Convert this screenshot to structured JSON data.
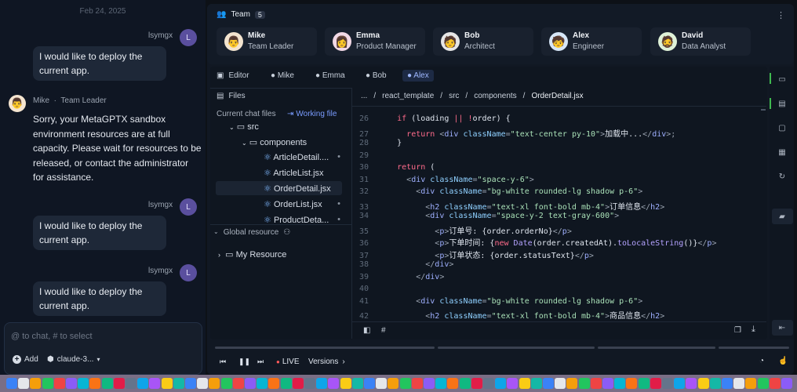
{
  "chat": {
    "date": "Feb 24, 2025",
    "user_name": "lsymgx",
    "user_initial": "L",
    "user_message": "I would like to deploy the current app.",
    "bot_name": "Mike",
    "bot_role": "Team Leader",
    "bot_message": "Sorry, your MetaGPTX sandbox environment resources are at full capacity. Please wait for resources to be released, or contact the administrator for assistance.",
    "input_placeholder": "@ to chat, # to select",
    "add_label": "Add",
    "model_label": "claude-3..."
  },
  "team": {
    "title": "Team",
    "count": "5",
    "members": [
      {
        "name": "Mike",
        "role": "Team Leader"
      },
      {
        "name": "Emma",
        "role": "Product Manager"
      },
      {
        "name": "Bob",
        "role": "Architect"
      },
      {
        "name": "Alex",
        "role": "Engineer"
      },
      {
        "name": "David",
        "role": "Data Analyst"
      }
    ]
  },
  "editor": {
    "title": "Editor",
    "tabs": [
      "Mike",
      "Emma",
      "Bob",
      "Alex"
    ],
    "active_tab": "Alex",
    "files_label": "Files",
    "current_chat_files": "Current chat files",
    "working_file": "Working file",
    "breadcrumb": [
      "...",
      "react_template",
      "src",
      "components",
      "OrderDetail.jsx"
    ],
    "tree": {
      "src": "src",
      "components": "components",
      "files": [
        "ArticleDetail....",
        "ArticleList.jsx",
        "OrderDetail.jsx",
        "OrderList.jsx",
        "ProductDeta..."
      ],
      "global_resource": "Global resource",
      "my_resource": "My Resource"
    },
    "code_lines": [
      {
        "n": "26",
        "html": "      <span class='kw'>if</span> <span class='pl'>(loading</span> <span class='kw'>||</span> <span class='kw'>!</span><span class='pl'>order) {</span>"
      },
      {
        "n": "27",
        "html": "        <span class='kw'>return</span> <span class='pu'>&lt;</span><span class='tg'>div</span> <span class='at'>className</span><span class='pu'>=</span><span class='st'>\"text-center py-10\"</span><span class='pu'>&gt;</span><span class='pl'>加载中...</span><span class='pu'>&lt;/</span><span class='tg'>div</span><span class='pu'>&gt;;</span>"
      },
      {
        "n": "28",
        "html": "      <span class='pl'>}</span>"
      },
      {
        "n": "29",
        "html": ""
      },
      {
        "n": "30",
        "html": "      <span class='kw'>return</span> <span class='pl'>(</span>"
      },
      {
        "n": "31",
        "html": "        <span class='pu'>&lt;</span><span class='tg'>div</span> <span class='at'>className</span><span class='pu'>=</span><span class='st'>\"space-y-6\"</span><span class='pu'>&gt;</span>"
      },
      {
        "n": "32",
        "html": "          <span class='pu'>&lt;</span><span class='tg'>div</span> <span class='at'>className</span><span class='pu'>=</span><span class='st'>\"bg-white rounded-lg shadow p-6\"</span><span class='pu'>&gt;</span>"
      },
      {
        "n": "33",
        "html": "            <span class='pu'>&lt;</span><span class='tg'>h2</span> <span class='at'>className</span><span class='pu'>=</span><span class='st'>\"text-xl font-bold mb-4\"</span><span class='pu'>&gt;</span><span class='pl'>订单信息</span><span class='pu'>&lt;/</span><span class='tg'>h2</span><span class='pu'>&gt;</span>"
      },
      {
        "n": "34",
        "html": "            <span class='pu'>&lt;</span><span class='tg'>div</span> <span class='at'>className</span><span class='pu'>=</span><span class='st'>\"space-y-2 text-gray-600\"</span><span class='pu'>&gt;</span>"
      },
      {
        "n": "35",
        "html": "              <span class='pu'>&lt;</span><span class='tg'>p</span><span class='pu'>&gt;</span><span class='pl'>订单号: {order.orderNo}</span><span class='pu'>&lt;/</span><span class='tg'>p</span><span class='pu'>&gt;</span>"
      },
      {
        "n": "36",
        "html": "              <span class='pu'>&lt;</span><span class='tg'>p</span><span class='pu'>&gt;</span><span class='pl'>下单时间: {</span><span class='kw'>new</span> <span class='fn'>Date</span><span class='pl'>(order.createdAt).</span><span class='fn'>toLocaleString</span><span class='pl'>()}</span><span class='pu'>&lt;/</span><span class='tg'>p</span><span class='pu'>&gt;</span>"
      },
      {
        "n": "37",
        "html": "              <span class='pu'>&lt;</span><span class='tg'>p</span><span class='pu'>&gt;</span><span class='pl'>订单状态: {order.statusText}</span><span class='pu'>&lt;/</span><span class='tg'>p</span><span class='pu'>&gt;</span>"
      },
      {
        "n": "38",
        "html": "            <span class='pu'>&lt;/</span><span class='tg'>div</span><span class='pu'>&gt;</span>"
      },
      {
        "n": "39",
        "html": "          <span class='pu'>&lt;/</span><span class='tg'>div</span><span class='pu'>&gt;</span>"
      },
      {
        "n": "40",
        "html": ""
      },
      {
        "n": "41",
        "html": "          <span class='pu'>&lt;</span><span class='tg'>div</span> <span class='at'>className</span><span class='pu'>=</span><span class='st'>\"bg-white rounded-lg shadow p-6\"</span><span class='pu'>&gt;</span>"
      },
      {
        "n": "42",
        "html": "            <span class='pu'>&lt;</span><span class='tg'>h2</span> <span class='at'>className</span><span class='pu'>=</span><span class='st'>\"text-xl font-bold mb-4\"</span><span class='pu'>&gt;</span><span class='pl'>商品信息</span><span class='pu'>&lt;/</span><span class='tg'>h2</span><span class='pu'>&gt;</span>"
      }
    ]
  },
  "player": {
    "live_label": "LIVE",
    "versions_label": "Versions"
  },
  "colors": {
    "accent": "#6b8cff",
    "user_avatar": "#5a4f9e",
    "sidebar_active": "#3fb950"
  }
}
